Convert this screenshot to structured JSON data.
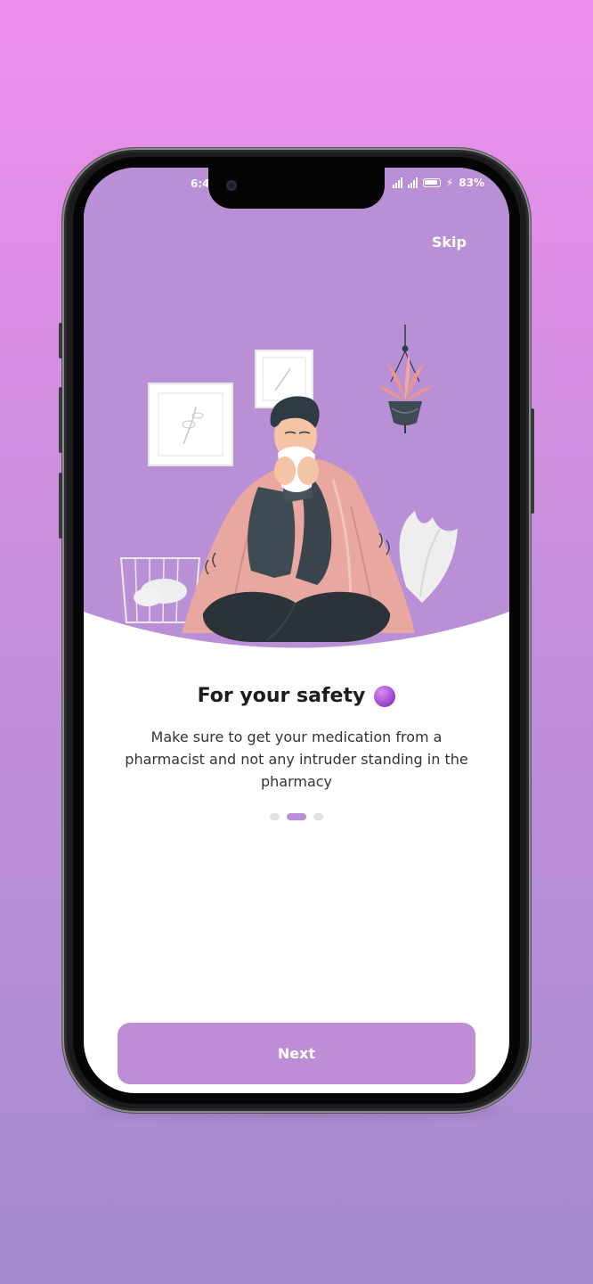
{
  "status_bar": {
    "time": "6:4",
    "battery_percent": "83%"
  },
  "onboarding": {
    "skip_label": "Skip",
    "title": "For your safety",
    "description": "Make sure to get your medication from a pharmacist and not any intruder standing in the pharmacy",
    "page_indicator": {
      "pages": 3,
      "active": 2
    },
    "next_label": "Next"
  },
  "colors": {
    "accent": "#b98fd5",
    "button": "#be8dd5",
    "background_top": "#ef8fec",
    "background_bottom": "#a58ccf"
  }
}
